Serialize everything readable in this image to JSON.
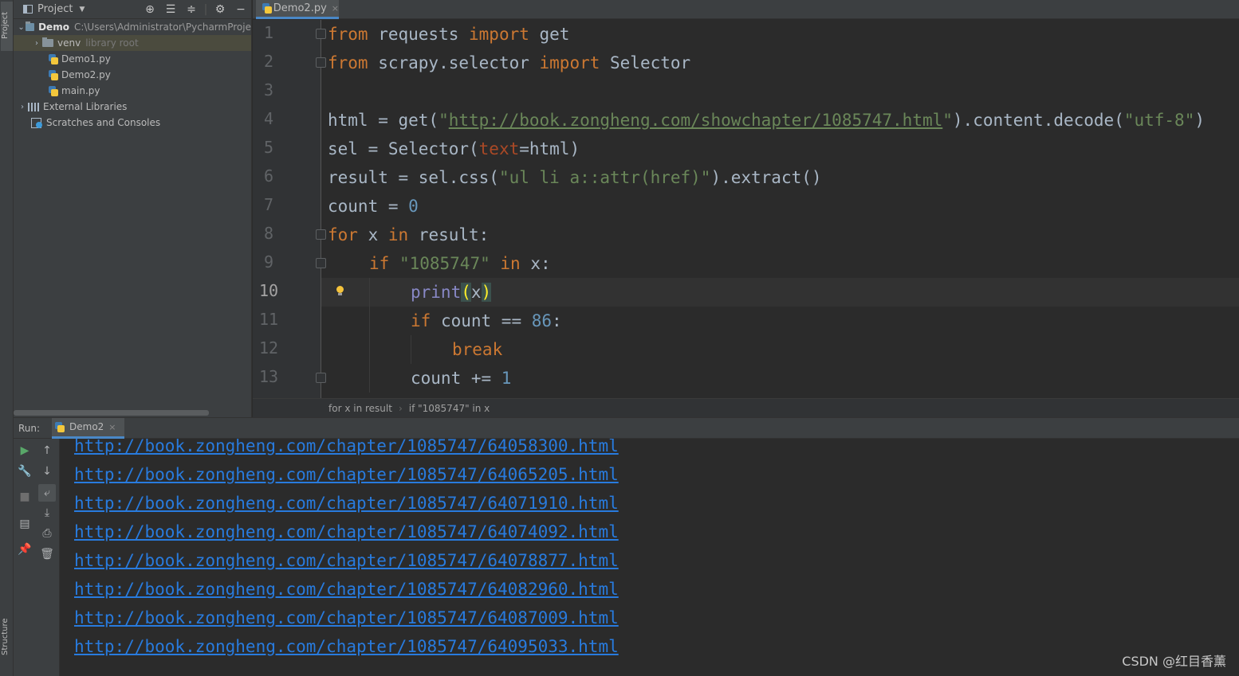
{
  "sidebar": {
    "project_tab": "Project",
    "structure_tab": "Structure"
  },
  "project_panel": {
    "title": "Project",
    "tools": [
      "crosshair-icon",
      "expand-icon",
      "collapse-icon",
      "gear-icon",
      "minimize-icon"
    ],
    "tree": {
      "root_name": "Demo",
      "root_path": "C:\\Users\\Administrator\\PycharmProje",
      "venv_name": "venv",
      "venv_hint": "library root",
      "files": [
        "Demo1.py",
        "Demo2.py",
        "main.py"
      ],
      "external_libraries": "External Libraries",
      "scratches": "Scratches and Consoles"
    }
  },
  "editor": {
    "tab_label": "Demo2.py",
    "line_numbers": [
      "1",
      "2",
      "3",
      "4",
      "5",
      "6",
      "7",
      "8",
      "9",
      "10",
      "11",
      "12",
      "13"
    ],
    "active_line": "10",
    "code": {
      "l1": {
        "from": "from",
        "mod": " requests ",
        "imp": "import",
        "name": " get"
      },
      "l2": {
        "from": "from",
        "mod": " scrapy.selector ",
        "imp": "import",
        "name": " Selector"
      },
      "l4": {
        "a": "html = get(",
        "q1": "\"",
        "url": "http://book.zongheng.com/showchapter/1085747.html",
        "q2": "\"",
        "b": ").content.decode(",
        "enc": "\"utf-8\"",
        "c": ")"
      },
      "l5": {
        "a": "sel = Selector(",
        "param": "text",
        "b": "=html)"
      },
      "l6": {
        "a": "result = sel.css(",
        "sel": "\"ul li a::attr(href)\"",
        "b": ").extract()"
      },
      "l7": {
        "a": "count = ",
        "num": "0"
      },
      "l8": {
        "kw1": "for",
        "a": " x ",
        "kw2": "in",
        "b": " result:"
      },
      "l9": {
        "kw1": "if",
        "str": " \"1085747\" ",
        "kw2": "in",
        "b": " x:"
      },
      "l10": {
        "fn": "print",
        "open": "(",
        "arg": "x",
        "close": ")"
      },
      "l11": {
        "kw": "if",
        "a": " count == ",
        "num": "86",
        "b": ":"
      },
      "l12": {
        "kw": "break"
      },
      "l13": {
        "a": "count += ",
        "num": "1"
      }
    }
  },
  "breadcrumb": {
    "items": [
      "for x in result",
      "if \"1085747\" in x"
    ],
    "separator": "›"
  },
  "run_window": {
    "label": "Run:",
    "tab_label": "Demo2",
    "output": [
      "http://book.zongheng.com/chapter/1085747/64058300.html",
      "http://book.zongheng.com/chapter/1085747/64065205.html",
      "http://book.zongheng.com/chapter/1085747/64071910.html",
      "http://book.zongheng.com/chapter/1085747/64074092.html",
      "http://book.zongheng.com/chapter/1085747/64078877.html",
      "http://book.zongheng.com/chapter/1085747/64082960.html",
      "http://book.zongheng.com/chapter/1085747/64087009.html",
      "http://book.zongheng.com/chapter/1085747/64095033.html"
    ]
  },
  "watermark": "CSDN @红目香薰",
  "colors": {
    "keyword": "#cc7832",
    "string": "#6a8759",
    "number": "#6897bb",
    "link": "#287bde",
    "background": "#2b2b2b",
    "panel": "#3c3f41"
  }
}
